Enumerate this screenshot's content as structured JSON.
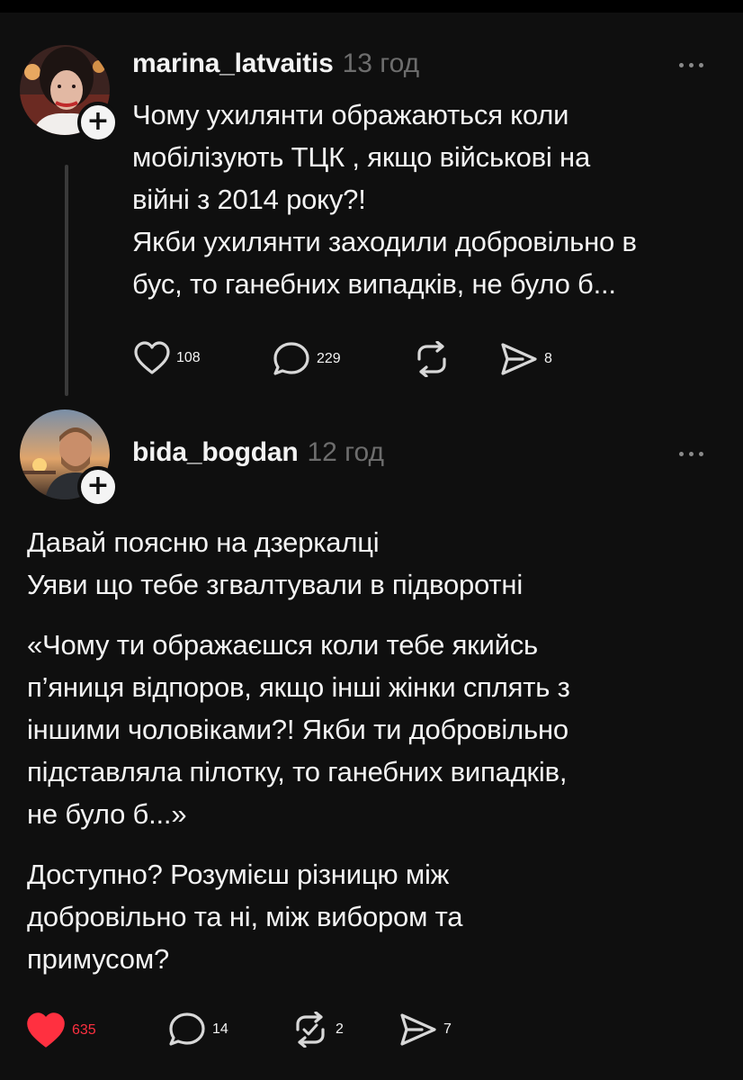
{
  "posts": [
    {
      "username": "marina_latvaitis",
      "time": "13 год",
      "lines": [
        "Чому ухилянти ображаються коли",
        "мобілізують ТЦК , якщо військові на",
        "війні з 2014 року?!",
        "Якби ухилянти заходили добровільно в",
        "бус,  то ганебних випадків, не було б..."
      ],
      "likes": "108",
      "comments": "229",
      "reposts": "",
      "shares": "8",
      "liked": false
    },
    {
      "username": "bida_bogdan",
      "time": "12 год",
      "paragraphs": [
        [
          "Давай поясню на дзеркалці",
          "Уяви що тебе згвалтували в підворотні"
        ],
        [
          "«Чому ти ображаєшся коли тебе якийсь",
          "п’яниця відпоров, якщо інші жінки сплять з",
          "іншими чоловіками?! Якби ти добровільно",
          "підставляла пілотку, то ганебних випадків,",
          "не було б...»"
        ],
        [
          "Доступно? Розумієш різницю між",
          "добровільно та ні, між вибором та",
          "примусом?"
        ]
      ],
      "likes": "635",
      "comments": "14",
      "reposts": "2",
      "shares": "7",
      "liked": true
    }
  ],
  "icons": {
    "like": "heart-icon",
    "comment": "comment-bubble-icon",
    "repost": "repost-icon",
    "share": "share-send-icon",
    "more": "more-dots-icon",
    "follow": "plus-icon"
  },
  "colors": {
    "background": "#0f0f0f",
    "text": "#f3f3f3",
    "muted": "#6d6d6d",
    "like_active": "#ff3040"
  }
}
